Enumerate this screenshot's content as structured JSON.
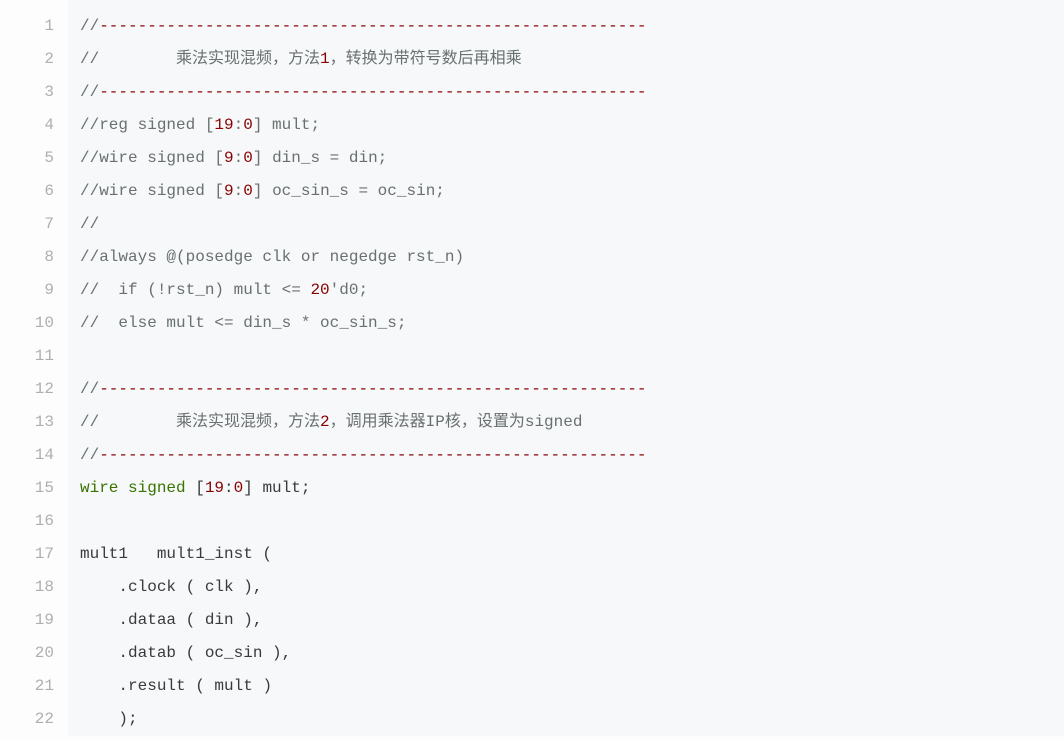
{
  "code": {
    "lineCount": 22,
    "lines": [
      {
        "n": 1,
        "tokens": [
          {
            "c": "cmt",
            "t": "//"
          },
          {
            "c": "dash",
            "t": "---------------------------------------------------------"
          }
        ]
      },
      {
        "n": 2,
        "tokens": [
          {
            "c": "cmt",
            "t": "//        乘法实现混频，方法"
          },
          {
            "c": "num",
            "t": "1"
          },
          {
            "c": "cmt",
            "t": "，转换为带符号数后再相乘"
          }
        ]
      },
      {
        "n": 3,
        "tokens": [
          {
            "c": "cmt",
            "t": "//"
          },
          {
            "c": "dash",
            "t": "---------------------------------------------------------"
          }
        ]
      },
      {
        "n": 4,
        "tokens": [
          {
            "c": "cmt",
            "t": "//reg signed ["
          },
          {
            "c": "num",
            "t": "19"
          },
          {
            "c": "cmt",
            "t": ":"
          },
          {
            "c": "num",
            "t": "0"
          },
          {
            "c": "cmt",
            "t": "] mult;"
          }
        ]
      },
      {
        "n": 5,
        "tokens": [
          {
            "c": "cmt",
            "t": "//wire signed ["
          },
          {
            "c": "num",
            "t": "9"
          },
          {
            "c": "cmt",
            "t": ":"
          },
          {
            "c": "num",
            "t": "0"
          },
          {
            "c": "cmt",
            "t": "] din_s = din;"
          }
        ]
      },
      {
        "n": 6,
        "tokens": [
          {
            "c": "cmt",
            "t": "//wire signed ["
          },
          {
            "c": "num",
            "t": "9"
          },
          {
            "c": "cmt",
            "t": ":"
          },
          {
            "c": "num",
            "t": "0"
          },
          {
            "c": "cmt",
            "t": "] oc_sin_s = oc_sin;"
          }
        ]
      },
      {
        "n": 7,
        "tokens": [
          {
            "c": "cmt",
            "t": "//"
          }
        ]
      },
      {
        "n": 8,
        "tokens": [
          {
            "c": "cmt",
            "t": "//always @(posedge clk or negedge rst_n)"
          }
        ]
      },
      {
        "n": 9,
        "tokens": [
          {
            "c": "cmt",
            "t": "//  if (!rst_n) mult <= "
          },
          {
            "c": "num",
            "t": "20"
          },
          {
            "c": "cmt",
            "t": "'d0;"
          }
        ]
      },
      {
        "n": 10,
        "tokens": [
          {
            "c": "cmt",
            "t": "//  else mult <= din_s * oc_sin_s;"
          }
        ]
      },
      {
        "n": 11,
        "tokens": []
      },
      {
        "n": 12,
        "tokens": [
          {
            "c": "cmt",
            "t": "//"
          },
          {
            "c": "dash",
            "t": "---------------------------------------------------------"
          }
        ]
      },
      {
        "n": 13,
        "tokens": [
          {
            "c": "cmt",
            "t": "//        乘法实现混频，方法"
          },
          {
            "c": "num",
            "t": "2"
          },
          {
            "c": "cmt",
            "t": "，调用乘法器IP核，设置为signed"
          }
        ]
      },
      {
        "n": 14,
        "tokens": [
          {
            "c": "cmt",
            "t": "//"
          },
          {
            "c": "dash",
            "t": "---------------------------------------------------------"
          }
        ]
      },
      {
        "n": 15,
        "tokens": [
          {
            "c": "kw",
            "t": "wire"
          },
          {
            "c": "id",
            "t": " "
          },
          {
            "c": "kw",
            "t": "signed"
          },
          {
            "c": "id",
            "t": " ["
          },
          {
            "c": "cn",
            "t": "19"
          },
          {
            "c": "id",
            "t": ":"
          },
          {
            "c": "cn",
            "t": "0"
          },
          {
            "c": "id",
            "t": "] mult;"
          }
        ]
      },
      {
        "n": 16,
        "tokens": []
      },
      {
        "n": 17,
        "tokens": [
          {
            "c": "id",
            "t": "mult1   mult1_inst ("
          }
        ]
      },
      {
        "n": 18,
        "tokens": [
          {
            "c": "id",
            "t": "    "
          },
          {
            "c": "id",
            "t": ".clock"
          },
          {
            "c": "id",
            "t": " ( clk ),"
          }
        ]
      },
      {
        "n": 19,
        "tokens": [
          {
            "c": "id",
            "t": "    "
          },
          {
            "c": "id",
            "t": ".dataa"
          },
          {
            "c": "id",
            "t": " ( din ),"
          }
        ]
      },
      {
        "n": 20,
        "tokens": [
          {
            "c": "id",
            "t": "    "
          },
          {
            "c": "id",
            "t": ".datab"
          },
          {
            "c": "id",
            "t": " ( oc_sin ),"
          }
        ]
      },
      {
        "n": 21,
        "tokens": [
          {
            "c": "id",
            "t": "    "
          },
          {
            "c": "id",
            "t": ".result"
          },
          {
            "c": "id",
            "t": " ( mult )"
          }
        ]
      },
      {
        "n": 22,
        "tokens": [
          {
            "c": "id",
            "t": "    );"
          }
        ]
      }
    ]
  }
}
